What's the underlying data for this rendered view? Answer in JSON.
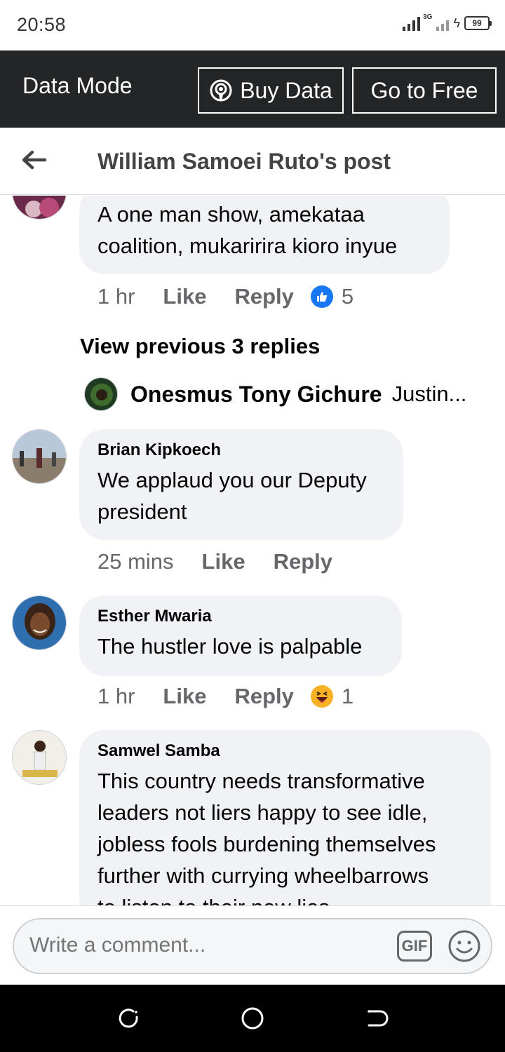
{
  "status_bar": {
    "time": "20:58",
    "network_label": "3G",
    "battery": "99"
  },
  "data_bar": {
    "mode_label": "Data Mode",
    "buy_label": "Buy Data",
    "free_label": "Go to Free"
  },
  "header": {
    "title": "William Samoei Ruto's post"
  },
  "comments": [
    {
      "name": "",
      "text_lines": [
        "A one man show, amekataa",
        "coalition, mukaririra kioro inyue"
      ],
      "time": "1 hr",
      "like": "Like",
      "reply": "Reply",
      "reaction": "like-icon",
      "reaction_count": "5"
    },
    {
      "name": "Brian Kipkoech",
      "text_lines": [
        "We applaud you our Deputy",
        "president"
      ],
      "time": "25 mins",
      "like": "Like",
      "reply": "Reply"
    },
    {
      "name": "Esther Mwaria",
      "text_lines": [
        "The hustler love is palpable"
      ],
      "time": "1 hr",
      "like": "Like",
      "reply": "Reply",
      "reaction": "haha-icon",
      "reaction_count": "1"
    },
    {
      "name": "Samwel Samba",
      "text_lines": [
        "This country needs transformative",
        "leaders not liers happy to see idle,",
        "jobless fools burdening themselves",
        "further with currying wheelbarrows",
        "to listen to their new lies"
      ]
    }
  ],
  "view_previous": "View previous 3 replies",
  "reply_preview": {
    "name": "Onesmus Tony Gichure",
    "text": "Justin..."
  },
  "composer": {
    "placeholder": "Write a comment...",
    "gif_label": "GIF"
  },
  "colors": {
    "data_bar_bg": "#242526",
    "bubble_bg": "#f0f2f5",
    "like_blue": "#1877f2",
    "haha_yellow": "#f7b125"
  }
}
